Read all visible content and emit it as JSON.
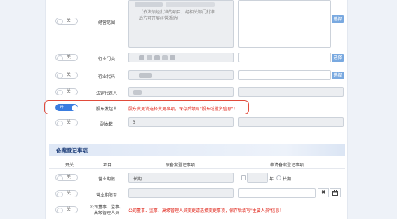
{
  "toggle_off": "关",
  "toggle_on": "开",
  "rows": {
    "business_scope": {
      "label": "经营范围",
      "note": "（依法须经批准的项目，经相关部门批准后方可开展经营活动）",
      "pick": "选择"
    },
    "industry_category": {
      "label": "行业门类",
      "pick": "选择"
    },
    "industry_code": {
      "label": "行业代码",
      "pick": "选择"
    },
    "legal_rep": {
      "label": "法定代表人"
    },
    "shareholders": {
      "label": "股东发起人",
      "notice": "股东变更请选择变更事项，保存后填写\"股东或投资信息\"！"
    },
    "copies": {
      "label": "副本数",
      "value": "3"
    }
  },
  "section": {
    "title": "备案登记事项",
    "columns": [
      "开关",
      "项目",
      "原备案登记事项",
      "申请备案登记事项"
    ],
    "rows": [
      {
        "item": "营业期限",
        "original": "长期",
        "year_unit": "年",
        "long_term": "长期"
      },
      {
        "item": "营业期限至"
      },
      {
        "item": "公司董事、监事、高级管理人员",
        "notice": "公司董事、监事、高级管理人员变更请选择变更事项，保存后填写\"主要人员\"信息！"
      }
    ]
  },
  "icons": {
    "clear": "clear-icon",
    "calendar": "calendar-icon"
  },
  "colors": {
    "accent": "#3a7de0",
    "notice": "#e0261b",
    "highlight_frame": "#e14b3b"
  }
}
